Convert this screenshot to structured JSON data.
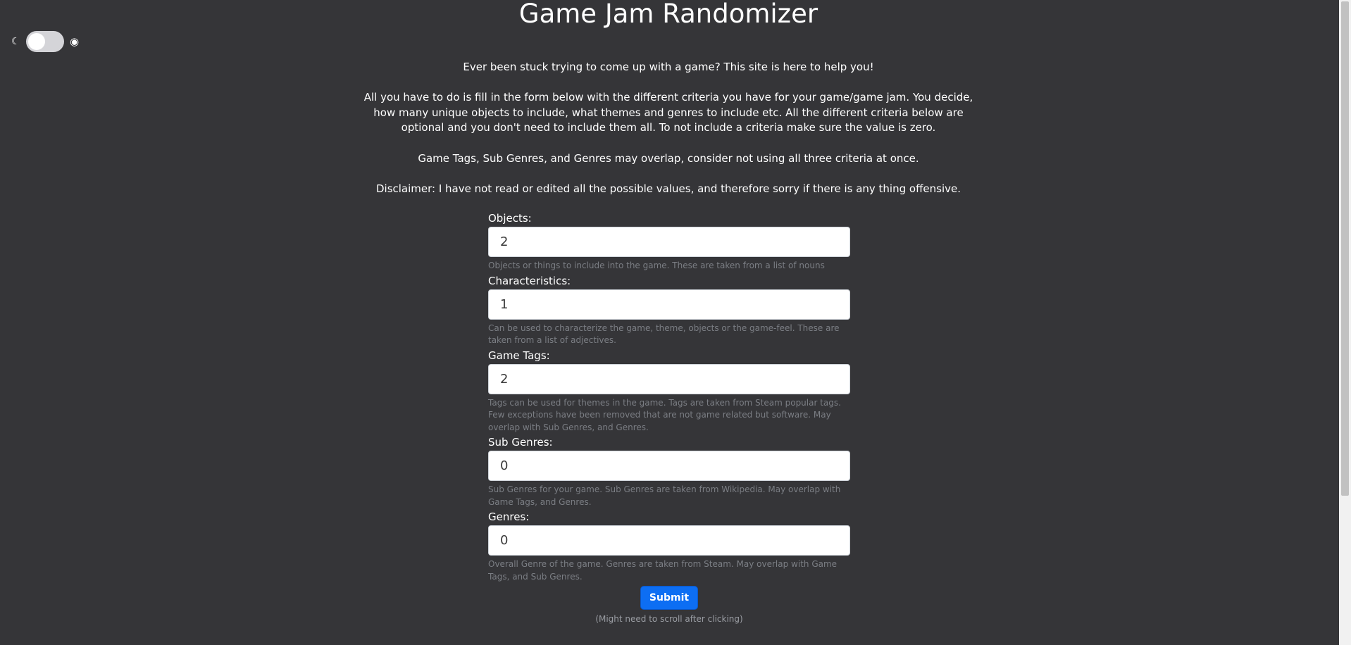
{
  "header": {
    "title": "Game Jam Randomizer"
  },
  "theme_toggle": {
    "dark_icon": "☾",
    "light_icon": "◉",
    "state": "off"
  },
  "intro": {
    "paragraphs": [
      "Ever been stuck trying to come up with a game? This site is here to help you!",
      "All you have to do is fill in the form below with the different criteria you have for your game/game jam. You decide, how many unique objects to include, what themes and genres to include etc. All the different criteria below are optional and you don't need to include them all. To not include a criteria make sure the value is zero.",
      "Game Tags, Sub Genres, and Genres may overlap, consider not using all three criteria at once.",
      "Disclaimer: I have not read or edited all the possible values, and therefore sorry if there is any thing offensive."
    ]
  },
  "form": {
    "fields": [
      {
        "label": "Objects:",
        "value": "2",
        "help": "Objects or things to include into the game. These are taken from a list of nouns"
      },
      {
        "label": "Characteristics:",
        "value": "1",
        "help": "Can be used to characterize the game, theme, objects or the game-feel. These are taken from a list of adjectives."
      },
      {
        "label": "Game Tags:",
        "value": "2",
        "help": "Tags can be used for themes in the game. Tags are taken from Steam popular tags. Few exceptions have been removed that are not game related but software. May overlap with Sub Genres, and Genres."
      },
      {
        "label": "Sub Genres:",
        "value": "0",
        "help": "Sub Genres for your game. Sub Genres are taken from Wikipedia. May overlap with Game Tags, and Genres."
      },
      {
        "label": "Genres:",
        "value": "0",
        "help": "Overall Genre of the game. Genres are taken from Steam. May overlap with Game Tags, and Sub Genres."
      }
    ],
    "submit_label": "Submit",
    "scroll_note": "(Might need to scroll after clicking)"
  },
  "colors": {
    "background": "#353538",
    "submit": "#0d6ef3",
    "help_text": "#7b7e84"
  }
}
